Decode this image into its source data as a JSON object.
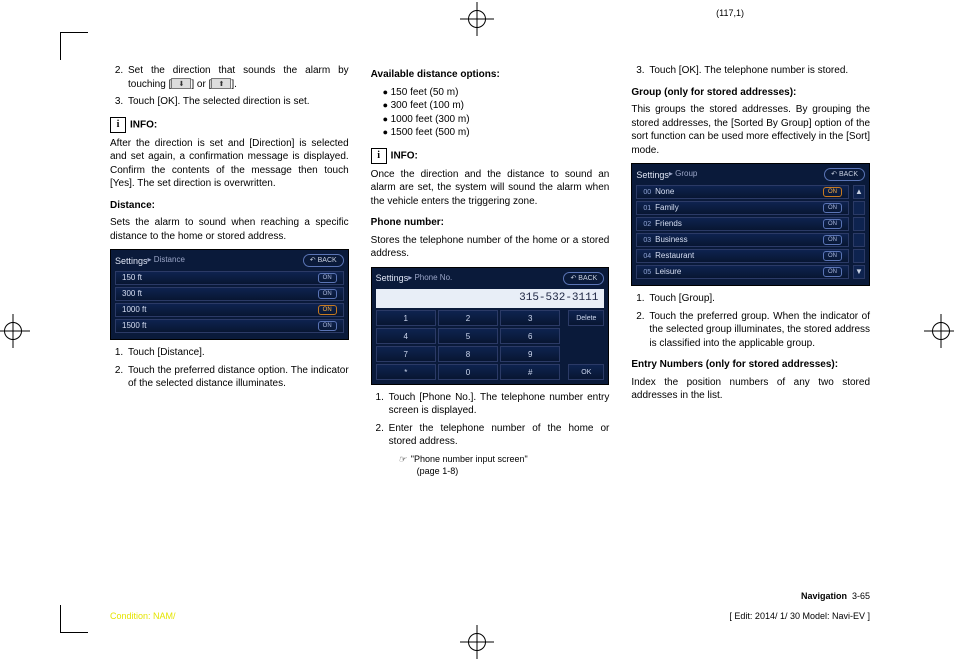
{
  "meta": {
    "coords": "(117,1)"
  },
  "col1": {
    "step2a": "Set the direction that sounds the alarm by touching [",
    "step2b": "] or [",
    "step2c": "].",
    "step3": "Touch [OK]. The selected direction is set.",
    "info_label": "INFO:",
    "info_body": "After the direction is set and [Direction] is selected and set again, a confirmation message is displayed. Confirm the contents of the message then touch [Yes]. The set direction is overwritten.",
    "distance_head": "Distance:",
    "distance_body": "Sets the alarm to sound when reaching a specific distance to the home or stored address.",
    "ss": {
      "title": "Settings",
      "bc": "▸ Distance",
      "back": "↶ BACK",
      "rows": [
        {
          "label": "150 ft",
          "lit": false
        },
        {
          "label": "300 ft",
          "lit": false
        },
        {
          "label": "1000 ft",
          "lit": true
        },
        {
          "label": "1500 ft",
          "lit": false
        }
      ],
      "on": "ON"
    },
    "step_a1": "Touch [Distance].",
    "step_a2": "Touch the preferred distance option. The indicator of the selected distance illuminates."
  },
  "col2": {
    "avail_head": "Available distance options:",
    "opts": [
      "150 feet (50 m)",
      "300 feet (100 m)",
      "1000 feet (300 m)",
      "1500 feet (500 m)"
    ],
    "info_label": "INFO:",
    "info_body": "Once the direction and the distance to sound an alarm are set, the system will sound the alarm when the vehicle enters the triggering zone.",
    "phone_head": "Phone number:",
    "phone_body": "Stores the telephone number of the home or a stored address.",
    "ss": {
      "title": "Settings",
      "bc": "▸ Phone No.",
      "back": "↶ BACK",
      "display": "315-532-3111",
      "keys": [
        [
          "1",
          "2",
          "3"
        ],
        [
          "4",
          "5",
          "6"
        ],
        [
          "7",
          "8",
          "9"
        ],
        [
          "*",
          "0",
          "#"
        ]
      ],
      "delete": "Delete",
      "ok": "OK"
    },
    "step_b1": "Touch [Phone No.]. The telephone number entry screen is displayed.",
    "step_b2": "Enter the telephone number of the home or stored address.",
    "ref_line1": "\"Phone number input screen\"",
    "ref_line2": "(page 1-8)"
  },
  "col3": {
    "step3": "Touch [OK]. The telephone number is stored.",
    "group_head": "Group (only for stored addresses):",
    "group_body": "This groups the stored addresses. By grouping the stored addresses, the [Sorted By Group] option of the sort function can be used more effectively in the [Sort] mode.",
    "ss": {
      "title": "Settings",
      "bc": "▸ Group",
      "back": "↶ BACK",
      "rows": [
        {
          "num": "00",
          "label": "None",
          "lit": true
        },
        {
          "num": "01",
          "label": "Family",
          "lit": false
        },
        {
          "num": "02",
          "label": "Friends",
          "lit": false
        },
        {
          "num": "03",
          "label": "Business",
          "lit": false
        },
        {
          "num": "04",
          "label": "Restaurant",
          "lit": false
        },
        {
          "num": "05",
          "label": "Leisure",
          "lit": false
        }
      ],
      "on": "ON"
    },
    "step_c1": "Touch [Group].",
    "step_c2": "Touch the preferred group. When the indicator of the selected group illuminates, the stored address is classified into the applicable group.",
    "entry_head": "Entry Numbers (only for stored addresses):",
    "entry_body": "Index the position numbers of any two stored addresses in the list."
  },
  "footer": {
    "nav_label": "Navigation",
    "nav_page": "3-65",
    "condition": "Condition: NAM/",
    "edit": "[ Edit: 2014/ 1/ 30   Model:  Navi-EV ]"
  }
}
